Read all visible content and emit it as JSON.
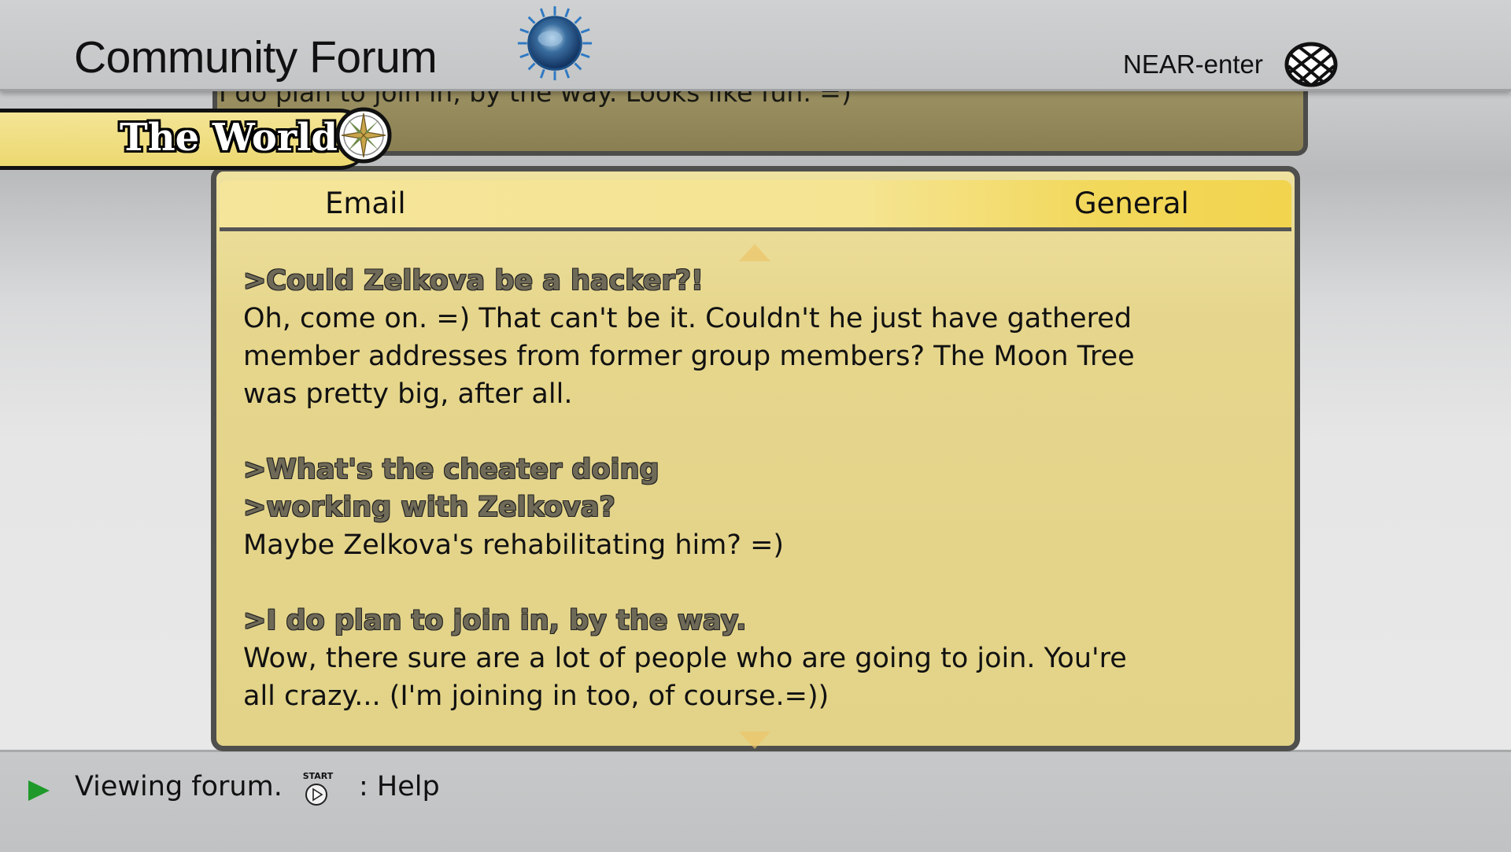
{
  "header": {
    "title": "Community Forum",
    "near_label": "NEAR-enter",
    "logo_icon": "globe-logo-icon",
    "near_icon": "network-globe-icon"
  },
  "world_tab": {
    "label": "The World",
    "icon": "compass-icon"
  },
  "previous_post": {
    "text": "I do plan to join in, by the way. Looks like fun. =)"
  },
  "tabs": {
    "email": "Email",
    "general": "General",
    "active": "General"
  },
  "message": {
    "quote1": ">Could Zelkova be a hacker?!",
    "reply1_line1": "Oh, come on. =) That can't be it. Couldn't he just have gathered",
    "reply1_line2": "member addresses from former group members? The Moon Tree",
    "reply1_line3": "was pretty big, after all.",
    "quote2_line1": ">What's the cheater doing",
    "quote2_line2": ">working with Zelkova?",
    "reply2": "Maybe Zelkova's rehabilitating him? =)",
    "quote3": ">I do plan to join in, by the way.",
    "reply3_line1": "Wow, there sure are a lot of people who are going to join. You're",
    "reply3_line2": "all crazy... (I'm joining in too, of course.=))"
  },
  "status_bar": {
    "status": "Viewing forum.",
    "help_button_label": "START",
    "help": ": Help"
  },
  "colors": {
    "panel": "#e2d388",
    "tab_accent": "#f2d44e",
    "status_arrow": "#1f9a2a"
  }
}
